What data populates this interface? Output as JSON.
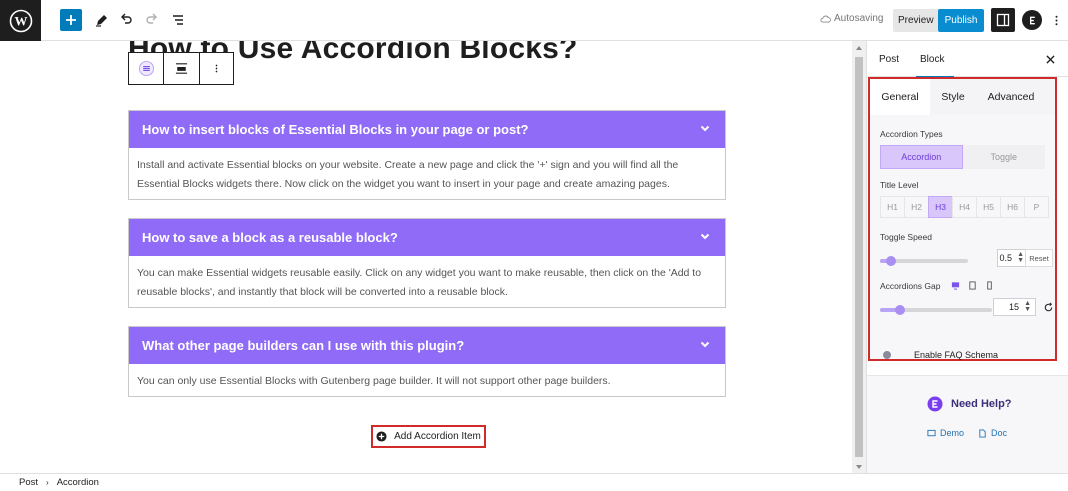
{
  "topbar": {
    "autosave_text": "Autosaving",
    "preview_label": "Preview",
    "publish_label": "Publish"
  },
  "editor": {
    "post_title": "How to Use Accordion Blocks?",
    "accordions": [
      {
        "title": "How to insert blocks of Essential Blocks in your page or post?",
        "body": "Install and activate Essential blocks on your website. Create a new page and click the '+' sign and you will find all the Essential Blocks widgets there. Now click on the widget you want to insert in your page and create amazing pages."
      },
      {
        "title": "How to save a block as a reusable block?",
        "body": "You can make Essential widgets reusable easily. Click on any widget you want to make reusable, then click on the 'Add to reusable blocks', and instantly that block will be converted into a reusable block."
      },
      {
        "title": "What other page builders can I use with this plugin?",
        "body": "You can only use Essential Blocks with Gutenberg page builder. It will not support other page builders."
      }
    ],
    "add_item_label": "Add Accordion Item"
  },
  "sidebar": {
    "tabs": [
      "Post",
      "Block"
    ],
    "active_tab": "Block",
    "inner_tabs": [
      "General",
      "Style",
      "Advanced"
    ],
    "accordion_types_label": "Accordion Types",
    "accordion_types": [
      "Accordion",
      "Toggle"
    ],
    "title_level_label": "Title Level",
    "title_levels": [
      "H1",
      "H2",
      "H3",
      "H4",
      "H5",
      "H6",
      "P"
    ],
    "title_level_selected": "H3",
    "toggle_speed_label": "Toggle Speed",
    "toggle_speed_value": "0.5",
    "reset_label": "Reset",
    "accordions_gap_label": "Accordions Gap",
    "accordions_gap_value": "15",
    "faq_schema_label": "Enable FAQ Schema",
    "help_title": "Need Help?",
    "help_links": [
      "Demo",
      "Doc"
    ]
  },
  "footer": {
    "breadcrumb": [
      "Post",
      "Accordion"
    ]
  },
  "colors": {
    "accordion_header": "#8f6bf7",
    "accent_purple": "#6c3bd8",
    "wp_blue": "#007cba",
    "highlight_red": "#d12a2a"
  }
}
